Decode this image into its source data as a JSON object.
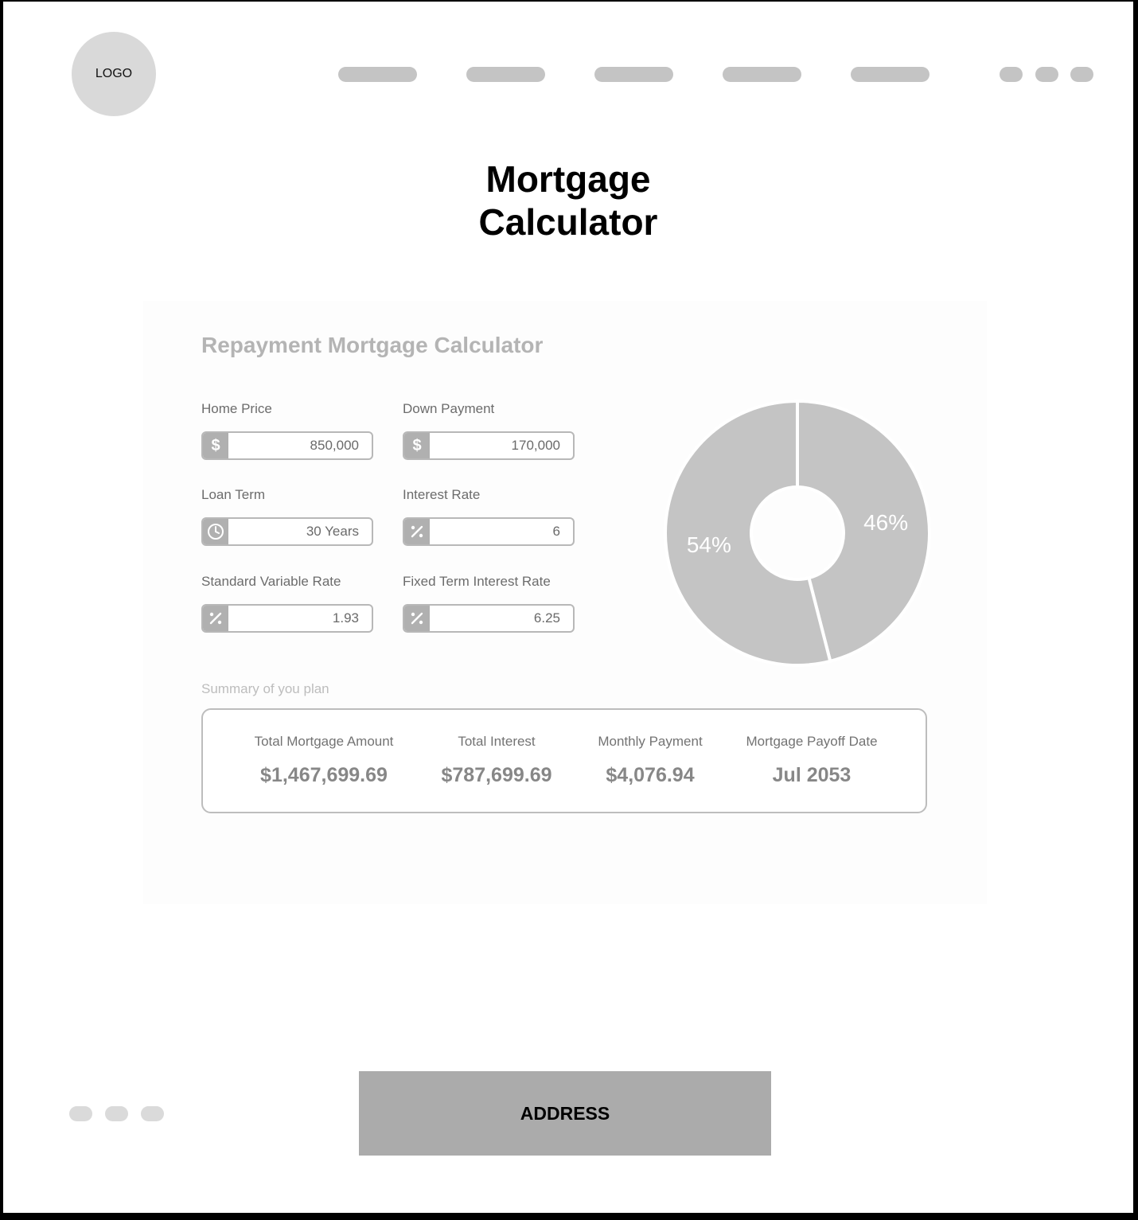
{
  "header": {
    "logo_label": "LOGO",
    "nav_items": 5,
    "action_dots": 3
  },
  "page_title_line1": "Mortgage",
  "page_title_line2": "Calculator",
  "calculator": {
    "title": "Repayment Mortgage Calculator",
    "fields": {
      "home_price": {
        "label": "Home Price",
        "value": "850,000",
        "icon": "dollar-icon"
      },
      "down_payment": {
        "label": "Down Payment",
        "value": "170,000",
        "icon": "dollar-icon"
      },
      "loan_term": {
        "label": "Loan Term",
        "value": "30 Years",
        "icon": "clock-icon"
      },
      "interest_rate": {
        "label": "Interest Rate",
        "value": "6",
        "icon": "percent-icon"
      },
      "standard_variable_rate": {
        "label": "Standard Variable Rate",
        "value": "1.93",
        "icon": "percent-icon"
      },
      "fixed_term_interest_rate": {
        "label": "Fixed Term Interest Rate",
        "value": "6.25",
        "icon": "percent-icon"
      }
    },
    "chart_data": {
      "type": "pie",
      "values": [
        46,
        54
      ],
      "labels": [
        "46%",
        "54%"
      ],
      "colors": [
        "#c4c4c4",
        "#c4c4c4"
      ],
      "hole": true
    }
  },
  "summary": {
    "label": "Summary of you plan",
    "items": [
      {
        "heading": "Total Mortgage Amount",
        "value": "$1,467,699.69"
      },
      {
        "heading": "Total Interest",
        "value": "$787,699.69"
      },
      {
        "heading": "Monthly Payment",
        "value": "$4,076.94"
      },
      {
        "heading": "Mortgage Payoff Date",
        "value": "Jul 2053"
      }
    ]
  },
  "footer": {
    "address_label": "ADDRESS",
    "dots": 3
  },
  "colors": {
    "placeholder_gray": "#c4c4c4",
    "chart_fill": "#c4c4c4",
    "address_bg": "#ababab"
  }
}
